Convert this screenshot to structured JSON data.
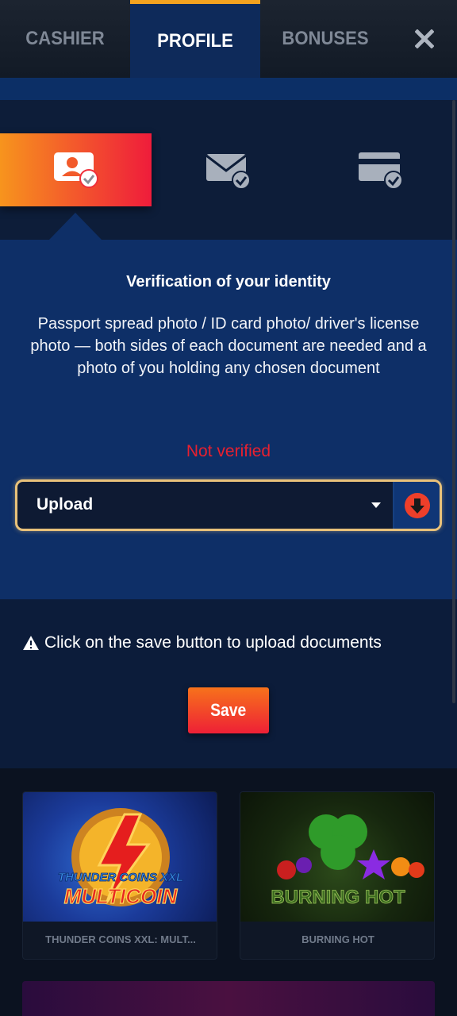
{
  "tabs": [
    {
      "label": "CASHIER"
    },
    {
      "label": "PROFILE"
    },
    {
      "label": "BONUSES"
    }
  ],
  "verification": {
    "title": "Verification of your identity",
    "description": "Passport spread photo / ID card photo/ driver's license photo — both sides of each document are needed and a photo of you holding any chosen document",
    "status": "Not verified",
    "upload_label": "Upload",
    "notice": "Click on the save button to upload documents",
    "save_label": "Save"
  },
  "games": [
    {
      "title": "THUNDER COINS XXL: MULT...",
      "logo_top": "THUNDER COINS XXL",
      "logo_bottom": "MULTICOIN"
    },
    {
      "title": "BURNING HOT",
      "logo": "BURNING HOT"
    }
  ],
  "colors": {
    "accent_orange": "#f7941d",
    "accent_red": "#ef1c3b",
    "status_red": "#e8202f",
    "panel_blue": "#0e2f67",
    "tab_indicator": "#f3a21f"
  },
  "icons": [
    "close-icon",
    "user-id-check-icon",
    "mail-check-icon",
    "card-check-icon",
    "download-icon",
    "warning-icon",
    "chevron-down-icon"
  ]
}
